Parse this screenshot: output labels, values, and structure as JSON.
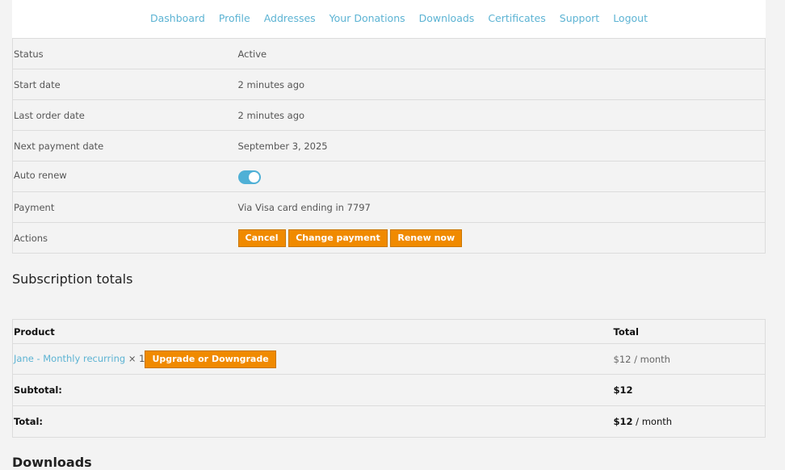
{
  "nav": [
    "Dashboard",
    "Profile",
    "Addresses",
    "Your Donations",
    "Downloads",
    "Certificates",
    "Support",
    "Logout"
  ],
  "details": {
    "status_label": "Status",
    "status_value": "Active",
    "start_label": "Start date",
    "start_value": "2 minutes ago",
    "last_order_label": "Last order date",
    "last_order_value": "2 minutes ago",
    "next_payment_label": "Next payment date",
    "next_payment_value": "September 3, 2025",
    "auto_renew_label": "Auto renew",
    "auto_renew_on": true,
    "payment_label": "Payment",
    "payment_value": "Via Visa card ending in 7797",
    "actions_label": "Actions",
    "cancel_label": "Cancel",
    "change_payment_label": "Change payment",
    "renew_label": "Renew now"
  },
  "totals": {
    "title": "Subscription totals",
    "col_product": "Product",
    "col_total": "Total",
    "product_name": "Jane - Monthly recurring",
    "product_qty": "× 1",
    "upgrade_label": "Upgrade or Downgrade",
    "product_total": "$12 / month",
    "subtotal_label": "Subtotal:",
    "subtotal_value": "$12",
    "total_label": "Total:",
    "total_amount": "$12",
    "total_period": " / month"
  },
  "next_section_title": "Downloads",
  "colors": {
    "accent": "#5cb3d3",
    "button": "#f08a00",
    "toggle": "#4fb0d6"
  }
}
